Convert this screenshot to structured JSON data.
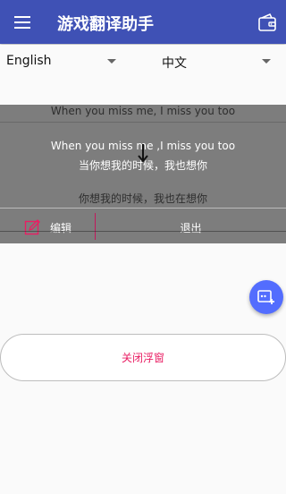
{
  "header": {
    "title": "游戏翻译助手"
  },
  "languages": {
    "source": "English",
    "target": "中文"
  },
  "float_window": {
    "dim_original": "When you miss me, I miss you too",
    "recognized_original": "When you miss me ,I miss you too",
    "translation": "当你想我的时候，我也想你",
    "dim_translation": "你想我的时候，我也在想你",
    "edit_label": "编辑",
    "exit_label": "退出"
  },
  "close_button": {
    "label": "关闭浮窗"
  },
  "colors": {
    "primary": "#3f51b5",
    "accent": "#e91e63",
    "fab": "#536dfe"
  },
  "icons": {
    "menu": "menu-icon",
    "wallet": "wallet-icon",
    "drag": "drag-arrow-icon",
    "edit": "edit-icon",
    "fab": "screen-translate-icon"
  }
}
